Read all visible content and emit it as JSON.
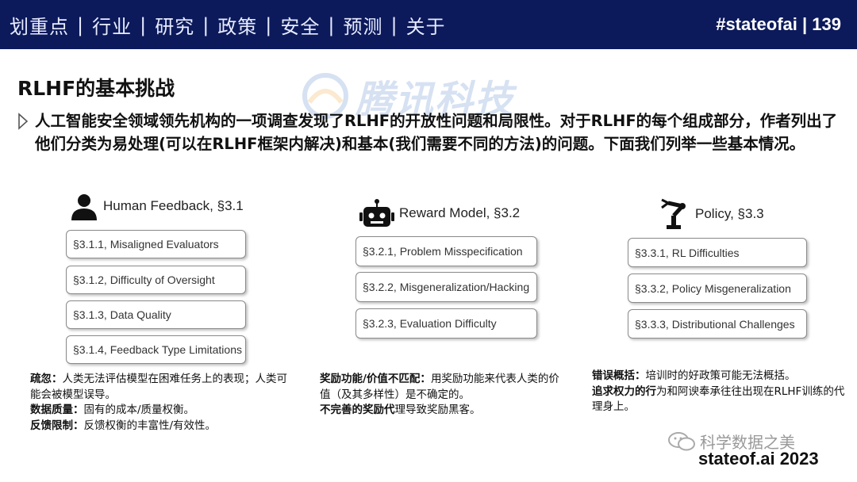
{
  "header": {
    "nav": [
      "划重点",
      "行业",
      "研究",
      "政策",
      "安全",
      "预测",
      "关于"
    ],
    "separator": "|",
    "slide_tag": "#stateofai | 139"
  },
  "watermark": {
    "text": "腾讯科技"
  },
  "title": "RLHF的基本挑战",
  "intro": "人工智能安全领域领先机构的一项调查发现了RLHF的开放性问题和局限性。对于RLHF的每个组成部分，作者列出了他们分类为易处理(可以在RLHF框架内解决)和基本(我们需要不同的方法)的问题。下面我们列举一些基本情况。",
  "columns": [
    {
      "heading": "Human Feedback, §3.1",
      "icon": "person-icon",
      "items": [
        "§3.1.1, Misaligned Evaluators",
        "§3.1.2, Difficulty of Oversight",
        "§3.1.3, Data Quality",
        "§3.1.4, Feedback Type Limitations"
      ],
      "notes": [
        {
          "label": "疏忽：",
          "text": "人类无法评估模型在困难任务上的表现；人类可能会被模型误导。"
        },
        {
          "label": "数据质量：",
          "text": "固有的成本/质量权衡。"
        },
        {
          "label": "反馈限制：",
          "text": "反馈权衡的丰富性/有效性。"
        }
      ]
    },
    {
      "heading": "Reward Model, §3.2",
      "icon": "robot-icon",
      "items": [
        "§3.2.1, Problem Misspecification",
        "§3.2.2, Misgeneralization/Hacking",
        "§3.2.3, Evaluation Difficulty"
      ],
      "notes": [
        {
          "label": "奖励功能/价值不匹配：",
          "text": "用奖励功能来代表人类的价值（及其多样性）是不确定的。"
        },
        {
          "label": "不完善的奖励代",
          "text": "理导致奖励黑客。"
        }
      ]
    },
    {
      "heading": "Policy, §3.3",
      "icon": "robot-arm-icon",
      "items": [
        "§3.3.1, RL Difficulties",
        "§3.3.2, Policy Misgeneralization",
        "§3.3.3, Distributional Challenges"
      ],
      "notes": [
        {
          "label": "错误概括：",
          "text": "培训时的好政策可能无法概括。"
        },
        {
          "label": "追求权力的行",
          "text": "为和阿谀奉承往往出现在RLHF训练的代理身上。"
        }
      ]
    }
  ],
  "footer": {
    "wechat": "科学数据之美",
    "brand": "stateof.ai 2023"
  },
  "colors": {
    "topbar": "#0c1a5b",
    "watermark": "#4a7cc9"
  }
}
